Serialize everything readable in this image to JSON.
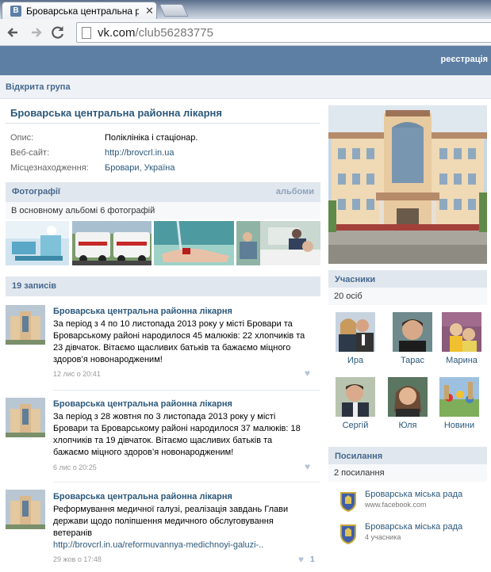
{
  "browser": {
    "tab_title": "Броварська центральна р",
    "favicon_letter": "В",
    "close_glyph": "✕",
    "url_host": "vk.com",
    "url_path": "/club56283775"
  },
  "vk_header": {
    "register": "реєстрація"
  },
  "group": {
    "type": "Відкрита група",
    "name": "Броварська центральна районна лікарня",
    "info": [
      {
        "label": "Опис:",
        "value": "Поліклініка і стаціонар."
      },
      {
        "label": "Веб-сайт:",
        "value": "http://brovcrl.in.ua"
      },
      {
        "label": "Місцезнаходження:",
        "value": "Бровари, Україна"
      }
    ]
  },
  "photos": {
    "title": "Фотографії",
    "albums_link": "альбоми",
    "summary": "В основному альбомі 6 фотографій"
  },
  "wall": {
    "count_label": "19 записів",
    "posts": [
      {
        "author": "Броварська центральна районна лікарня",
        "lines": [
          "За період з 4 по 10 листопада 2013 року у місті Бровари та",
          "Броварському районі народилося 45 малюків: 22 хлопчиків та",
          "23 дівчаток. Вітаємо щасливих батьків та бажаємо міцного",
          "здоров’я новонародженим!"
        ],
        "date": "12 лис о 20:41"
      },
      {
        "author": "Броварська центральна районна лікарня",
        "lines": [
          "За період з 28 жовтня по 3 листопада 2013 року у місті",
          "Бровари та Броварському районі народилося 37 малюків: 18",
          "хлопчиків та 19 дівчаток. Вітаємо щасливих батьків та",
          "бажаємо міцного здоров’я новонародженим!"
        ],
        "date": "6 лис о 20:25"
      },
      {
        "author": "Броварська центральна районна лікарня",
        "lines": [
          "Реформування медичної галузі, реалізація завдань Глави",
          "держави щодо поліпшення медичного обслуговування",
          "ветеранів"
        ],
        "link": "http://brovcrl.in.ua/reformuvannya-medichnoyi-galuzi-..",
        "date": "29 жов о 17:48",
        "likes": "1"
      }
    ]
  },
  "members": {
    "title": "Учасники",
    "count": "20 осіб",
    "people": [
      "Ира",
      "Тарас",
      "Марина",
      "Сергій",
      "Юля",
      "Новини"
    ]
  },
  "links": {
    "title": "Посилання",
    "count": "2 посилання",
    "items": [
      {
        "title": "Броварська міська рада",
        "sub": "www.facebook.com"
      },
      {
        "title": "Броварська міська рада",
        "sub": "4 учасника"
      }
    ]
  },
  "colors": {
    "vk_header": "#5e7fa4",
    "link": "#2b587a",
    "section_bg": "#e1e7ee"
  }
}
